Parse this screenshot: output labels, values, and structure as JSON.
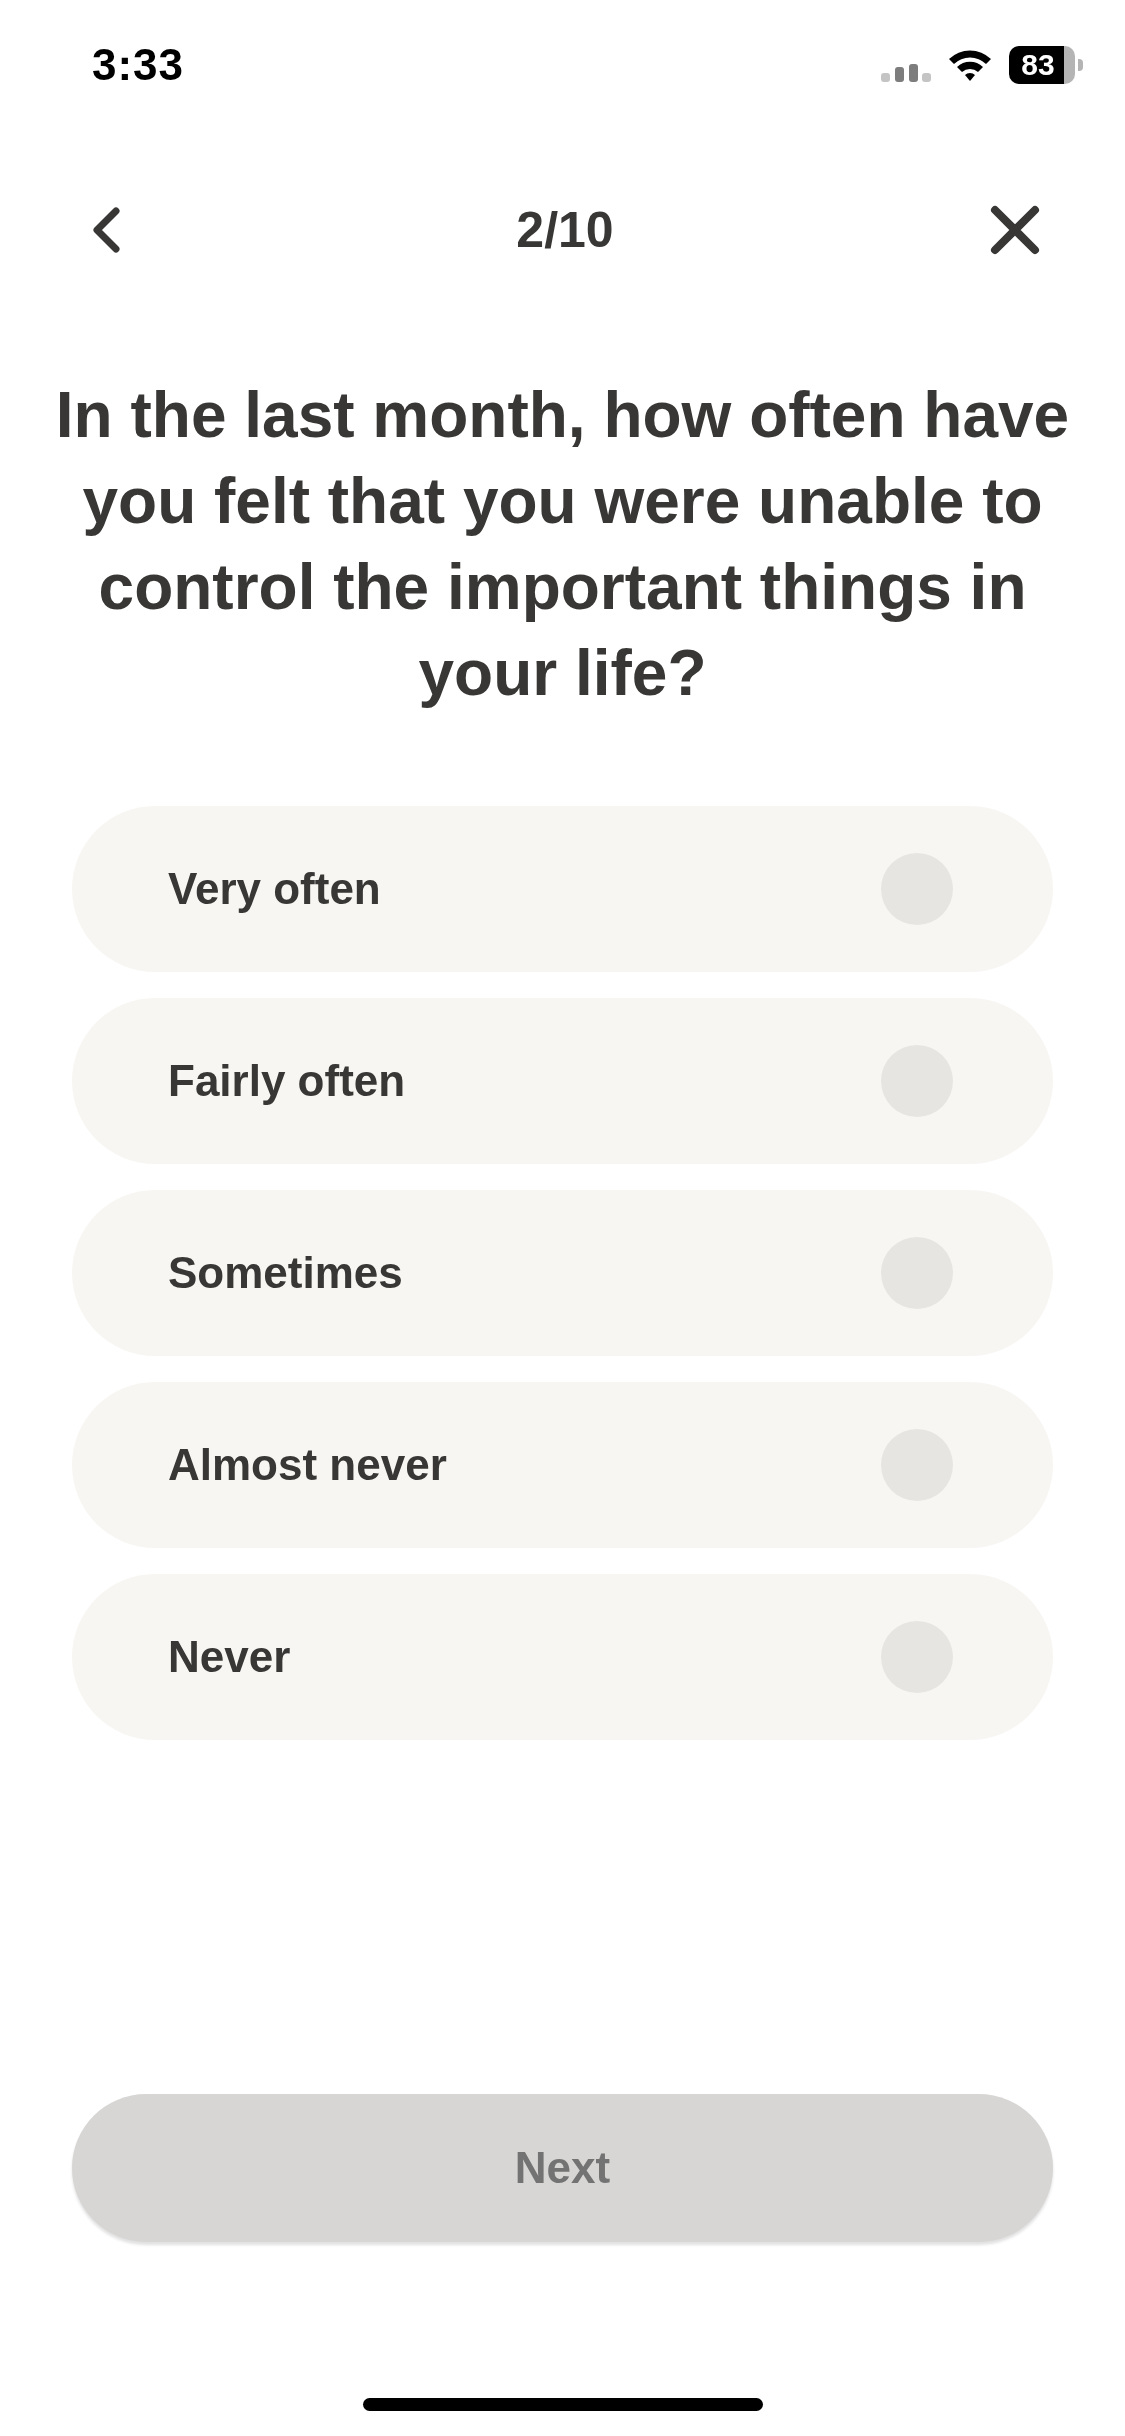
{
  "status_bar": {
    "time": "3:33",
    "battery": "83"
  },
  "header": {
    "progress": "2/10"
  },
  "question": "In the last month, how often have you felt that you were unable to control the important things in your life?",
  "options": [
    {
      "label": "Very often",
      "selected": false
    },
    {
      "label": "Fairly often",
      "selected": false
    },
    {
      "label": "Sometimes",
      "selected": false
    },
    {
      "label": "Almost never",
      "selected": false
    },
    {
      "label": "Never",
      "selected": false
    }
  ],
  "next_button": {
    "label": "Next",
    "disabled": true
  }
}
